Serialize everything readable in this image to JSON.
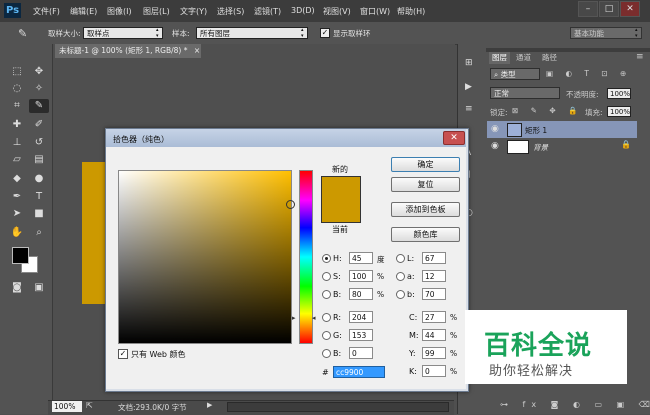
{
  "app": {
    "logo": "Ps",
    "menu": [
      "文件(F)",
      "编辑(E)",
      "图像(I)",
      "图层(L)",
      "文字(Y)",
      "选择(S)",
      "滤镜(T)",
      "3D(D)",
      "视图(V)",
      "窗口(W)",
      "帮助(H)"
    ],
    "window_buttons": [
      "–",
      "□",
      "✕"
    ]
  },
  "options_bar": {
    "sample_size_label": "取样大小:",
    "sample_size_value": "取样点",
    "sample_label": "样本:",
    "sample_value": "所有图层",
    "show_ring_label": "显示取样环",
    "show_ring_checked": true,
    "workspace": "基本功能"
  },
  "document": {
    "tab_title": "未标题-1 @ 100% (矩形 1, RGB/8) *",
    "tab_close": "×",
    "zoom": "100%",
    "info": "文档:293.0K/0 字节",
    "fill_color": "#cc9900"
  },
  "layers_panel": {
    "tabs": [
      "图层",
      "通道",
      "路径"
    ],
    "kind_filter": "类型",
    "blend_mode": "正常",
    "opacity_label": "不透明度:",
    "opacity_value": "100%",
    "lock_label": "锁定:",
    "fill_label": "填充:",
    "fill_value": "100%",
    "layers": [
      {
        "name": "矩形 1",
        "selected": true
      },
      {
        "name": "背景",
        "selected": false
      }
    ]
  },
  "picker": {
    "title": "拾色器（纯色）",
    "close": "✕",
    "new_label": "新的",
    "current_label": "当前",
    "new_color": "#cc9900",
    "current_color": "#cc9900",
    "buttons": {
      "ok": "确定",
      "reset": "复位",
      "add_swatch": "添加到色板",
      "libraries": "颜色库"
    },
    "hsb": [
      {
        "label": "H:",
        "value": "45",
        "unit": "度",
        "checked": true
      },
      {
        "label": "S:",
        "value": "100",
        "unit": "%",
        "checked": false
      },
      {
        "label": "B:",
        "value": "80",
        "unit": "%",
        "checked": false
      }
    ],
    "rgb": [
      {
        "label": "R:",
        "value": "204"
      },
      {
        "label": "G:",
        "value": "153"
      },
      {
        "label": "B:",
        "value": "0"
      }
    ],
    "lab": [
      {
        "label": "L:",
        "value": "67"
      },
      {
        "label": "a:",
        "value": "12"
      },
      {
        "label": "b:",
        "value": "70"
      }
    ],
    "cmyk": [
      {
        "label": "C:",
        "value": "27",
        "unit": "%"
      },
      {
        "label": "M:",
        "value": "44",
        "unit": "%"
      },
      {
        "label": "Y:",
        "value": "99",
        "unit": "%"
      },
      {
        "label": "K:",
        "value": "0",
        "unit": "%"
      }
    ],
    "hex_label": "#",
    "hex_value": "cc9900",
    "web_only_label": "只有 Web 颜色",
    "web_only_checked": true
  },
  "watermark": {
    "title": "百科全说",
    "subtitle": "助你轻松解决"
  }
}
